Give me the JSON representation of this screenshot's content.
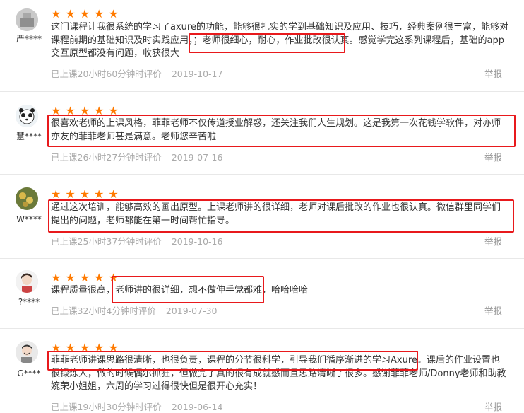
{
  "reviews": [
    {
      "user": "严****",
      "stars": 5,
      "content": "这门课程让我很系统的学习了axure的功能，能够很扎实的学到基础知识及应用、技巧，经典案例很丰富，能够对课程前期的基础知识及时实践应用，；老师很细心，耐心，作业批改很认真。感觉学完这系列课程后，基础的app交互原型都没有问题，收获很大",
      "duration": "已上课20小时60分钟时评价",
      "date": "2019-10-17",
      "report": "举报"
    },
    {
      "user": "慧****",
      "stars": 5,
      "content": "很喜欢老师的上课风格，菲菲老师不仅传道授业解惑，还关注我们人生规划。这是我第一次花钱学软件，对亦师亦友的菲菲老师甚是满意。老师您辛苦啦",
      "duration": "已上课26小时27分钟时评价",
      "date": "2019-07-16",
      "report": "举报"
    },
    {
      "user": "W****",
      "stars": 5,
      "content": "通过这次培训，能够高效的画出原型。上课老师讲的很详细，老师对课后批改的作业也很认真。微信群里同学们提出的问题，老师都能在第一时间帮忙指导。",
      "duration": "已上课25小时37分钟时评价",
      "date": "2019-10-16",
      "report": "举报"
    },
    {
      "user": "?****",
      "stars": 5,
      "content": "课程质量很高，老师讲的很详细，想不做伸手党都难，哈哈哈哈",
      "duration": "已上课32小时4分钟时评价",
      "date": "2019-07-30",
      "report": "举报"
    },
    {
      "user": "G****",
      "stars": 5,
      "content": "菲菲老师讲课思路很清晰，也很负责，课程的分节很科学，引导我们循序渐进的学习Axure。课后的作业设置也很锻炼人，做的时候偶尔抓狂，但做完了真的很有成就感而且思路清晰了很多。感谢菲菲老师/Donny老师和助教婉荣小姐姐，六周的学习过得很快但是很开心充实！",
      "duration": "已上课19小时30分钟时评价",
      "date": "2019-06-14",
      "report": "举报"
    }
  ],
  "colors": {
    "star": "#ff7a00",
    "highlight": "#e8191c",
    "meta": "#aaaaaa"
  }
}
